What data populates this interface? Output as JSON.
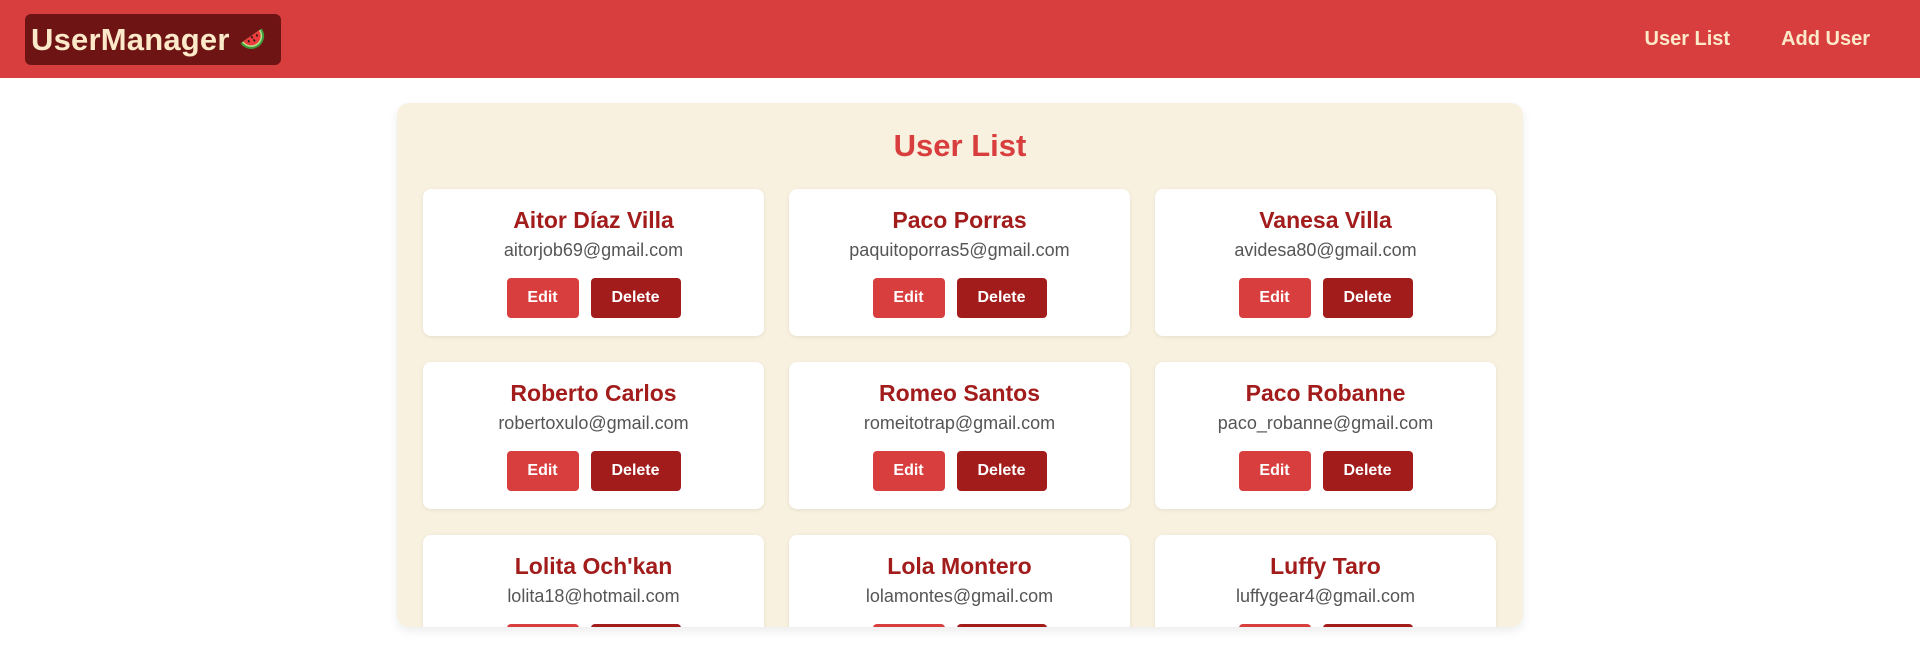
{
  "brand": {
    "name": "UserManager",
    "icon": "watermelon-icon"
  },
  "nav": {
    "user_list": "User List",
    "add_user": "Add User"
  },
  "page_title": "User List",
  "buttons": {
    "edit": "Edit",
    "delete": "Delete"
  },
  "users": [
    {
      "name": "Aitor Díaz Villa",
      "email": "aitorjob69@gmail.com"
    },
    {
      "name": "Paco Porras",
      "email": "paquitoporras5@gmail.com"
    },
    {
      "name": "Vanesa Villa",
      "email": "avidesa80@gmail.com"
    },
    {
      "name": "Roberto Carlos",
      "email": "robertoxulo@gmail.com"
    },
    {
      "name": "Romeo Santos",
      "email": "romeitotrap@gmail.com"
    },
    {
      "name": "Paco Robanne",
      "email": "paco_robanne@gmail.com"
    },
    {
      "name": "Lolita Och'kan",
      "email": "lolita18@hotmail.com"
    },
    {
      "name": "Lola Montero",
      "email": "lolamontes@gmail.com"
    },
    {
      "name": "Luffy Taro",
      "email": "luffygear4@gmail.com"
    }
  ],
  "colors": {
    "primary": "#d93e3e",
    "dark": "#a31c1c",
    "brand_bg": "#6e1414",
    "cream": "#fbe9c9",
    "panel_bg": "#f9f1df"
  }
}
